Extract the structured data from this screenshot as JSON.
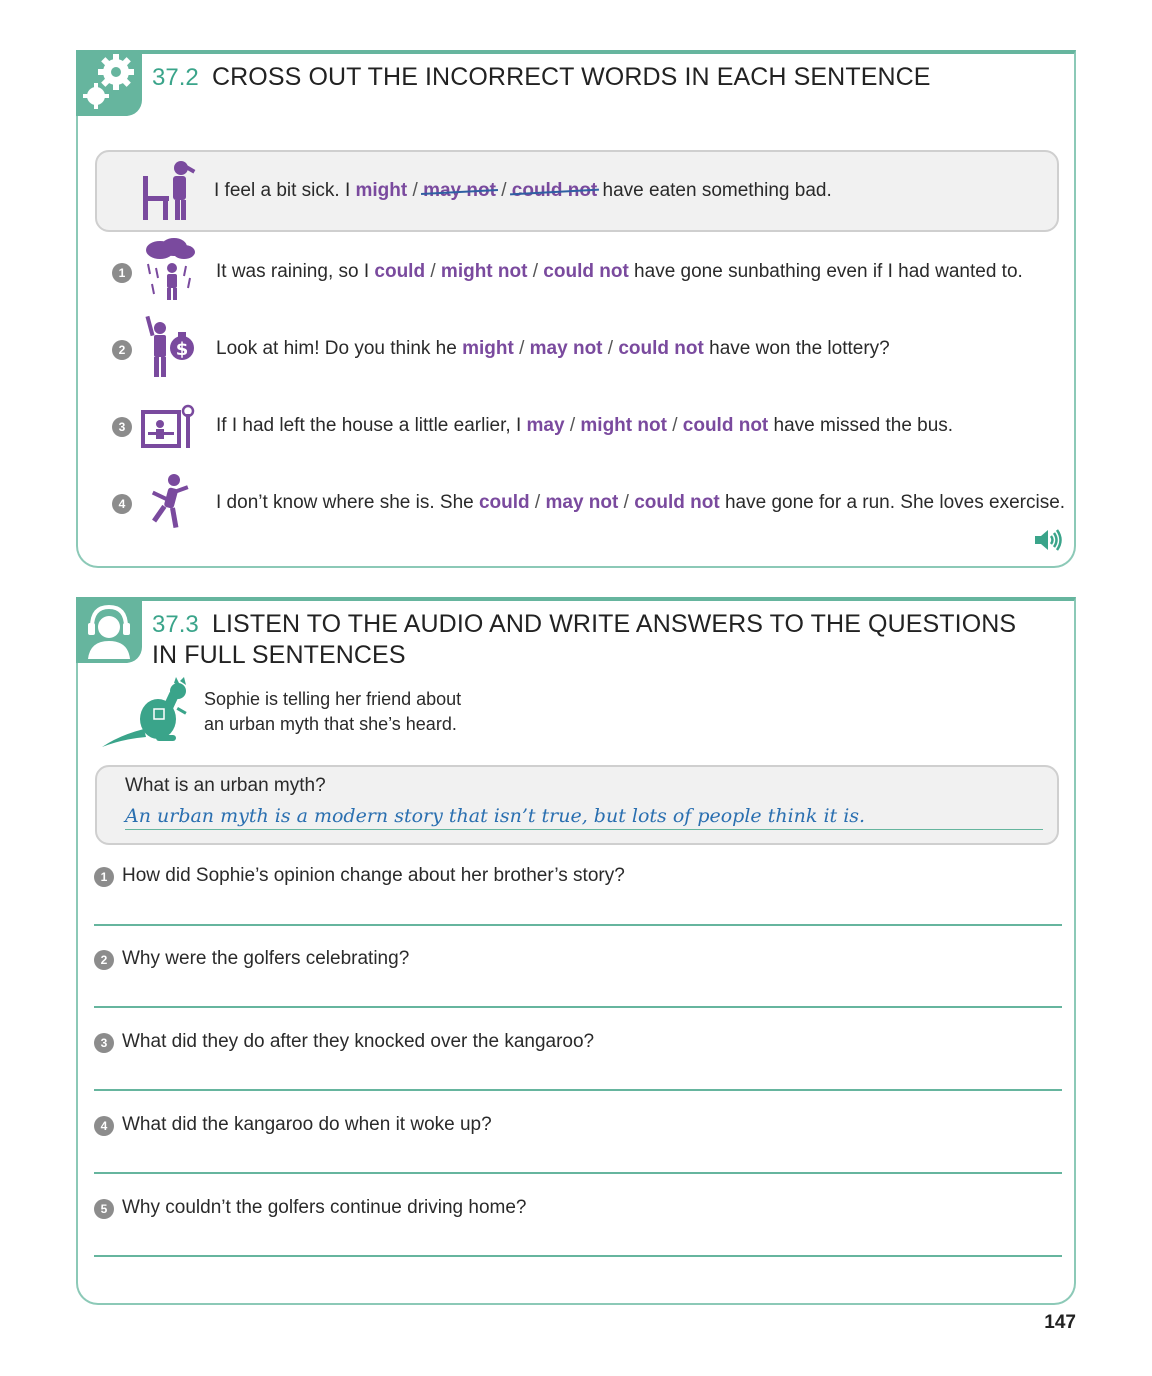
{
  "ex372": {
    "num": "37.2",
    "title": "CROSS OUT THE INCORRECT WORDS IN EACH SENTENCE",
    "example": {
      "pre": "I feel a bit sick. I ",
      "o1": "might",
      "s1": " / ",
      "o2": "may not",
      "s2": " / ",
      "o3": "could not",
      "post": " have eaten something bad."
    },
    "items": [
      {
        "n": "1",
        "pre": "It was raining, so I ",
        "o1": "could",
        "s1": " / ",
        "o2": "might not",
        "s2": " / ",
        "o3": "could not",
        "post": " have gone sunbathing even if I had wanted to."
      },
      {
        "n": "2",
        "pre": "Look at him! Do you think he ",
        "o1": "might",
        "s1": " / ",
        "o2": "may not",
        "s2": " / ",
        "o3": "could not",
        "post": " have won the lottery?"
      },
      {
        "n": "3",
        "pre": "If I had left the house a little earlier, I ",
        "o1": "may",
        "s1": " / ",
        "o2": "might not",
        "s2": " / ",
        "o3": "could not",
        "post": " have missed the bus."
      },
      {
        "n": "4",
        "pre": "I don’t know where she is. She ",
        "o1": "could",
        "s1": " / ",
        "o2": "may not",
        "s2": " / ",
        "o3": "could not",
        "post": " have gone for a run. She loves exercise."
      }
    ]
  },
  "ex373": {
    "num": "37.3",
    "title_line1": "LISTEN TO THE AUDIO AND WRITE ANSWERS TO THE QUESTIONS",
    "title_line2": "IN FULL SENTENCES",
    "intro_line1": "Sophie is telling her friend about",
    "intro_line2": "an urban myth that she’s heard.",
    "example_q": "What is an urban myth?",
    "example_a": "An urban myth is a modern story that isn’t true, but lots of people think it is.",
    "questions": [
      {
        "n": "1",
        "text": "How did Sophie’s opinion change about her brother’s story?"
      },
      {
        "n": "2",
        "text": "Why were the golfers celebrating?"
      },
      {
        "n": "3",
        "text": "What did they do after they knocked over the kangaroo?"
      },
      {
        "n": "4",
        "text": "What did the kangaroo do when it woke up?"
      },
      {
        "n": "5",
        "text": "Why couldn’t the golfers continue driving home?"
      }
    ]
  },
  "page_number": "147",
  "colors": {
    "accent": "#66b59e",
    "option": "#7a4a9e",
    "handwriting": "#2a6fb0"
  },
  "icons": [
    "gear-icon",
    "speaker-icon",
    "headphones-icon",
    "kangaroo-icon"
  ]
}
